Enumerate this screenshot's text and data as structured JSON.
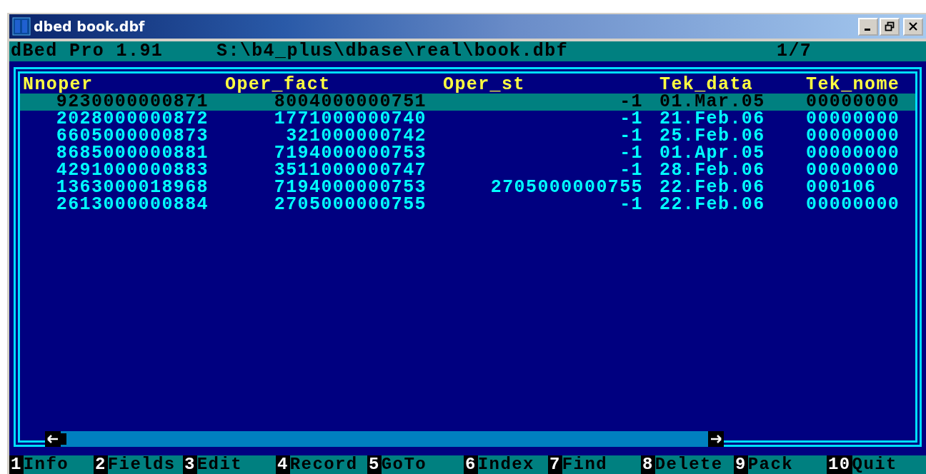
{
  "window": {
    "title": "dbed book.dbf"
  },
  "info_line": {
    "program": "dBed Pro 1.91",
    "path": "S:\\b4_plus\\dbase\\real\\book.dbf",
    "record": "1/7"
  },
  "table": {
    "columns": [
      {
        "label": "Nnoper",
        "kind": "number"
      },
      {
        "label": "Oper_fact",
        "kind": "number"
      },
      {
        "label": "Oper_st",
        "kind": "number"
      },
      {
        "label": "Tek_data",
        "kind": "text"
      },
      {
        "label": "Tek_nome",
        "kind": "text"
      }
    ],
    "rows": [
      {
        "selected": true,
        "cells": [
          "9230000000871",
          "8004000000751",
          "-1",
          "01.Mar.05",
          "00000000"
        ]
      },
      {
        "selected": false,
        "cells": [
          "2028000000872",
          "1771000000740",
          "-1",
          "21.Feb.06",
          "00000000"
        ]
      },
      {
        "selected": false,
        "cells": [
          "6605000000873",
          "321000000742",
          "-1",
          "25.Feb.06",
          "00000000"
        ]
      },
      {
        "selected": false,
        "cells": [
          "8685000000881",
          "7194000000753",
          "-1",
          "01.Apr.05",
          "00000000"
        ]
      },
      {
        "selected": false,
        "cells": [
          "4291000000883",
          "3511000000747",
          "-1",
          "28.Feb.06",
          "00000000"
        ]
      },
      {
        "selected": false,
        "cells": [
          "1363000018968",
          "7194000000753",
          "2705000000755",
          "22.Feb.06",
          "000106"
        ]
      },
      {
        "selected": false,
        "cells": [
          "2613000000884",
          "2705000000755",
          "-1",
          "22.Feb.06",
          "00000000"
        ]
      }
    ]
  },
  "function_keys": [
    {
      "key": "1",
      "label": "Info"
    },
    {
      "key": "2",
      "label": "Fields"
    },
    {
      "key": "3",
      "label": "Edit"
    },
    {
      "key": "4",
      "label": "Record"
    },
    {
      "key": "5",
      "label": "GoTo"
    },
    {
      "key": "6",
      "label": "Index"
    },
    {
      "key": "7",
      "label": "Find"
    },
    {
      "key": "8",
      "label": "Delete"
    },
    {
      "key": "9",
      "label": "Pack"
    },
    {
      "key": "10",
      "label": "Quit"
    }
  ]
}
